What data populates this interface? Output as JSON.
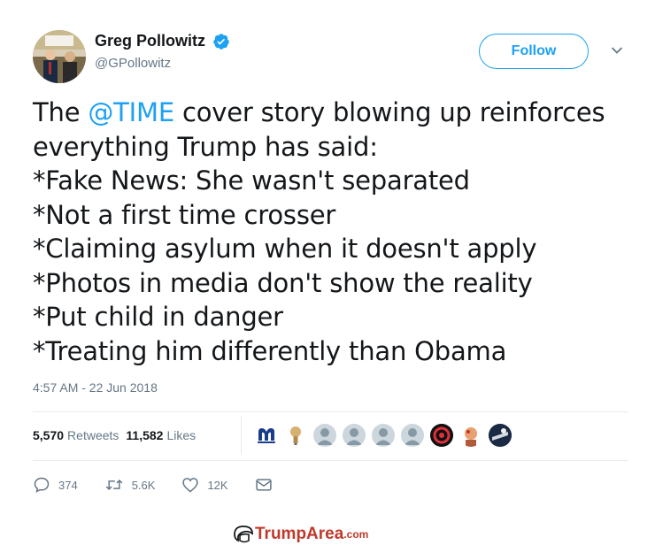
{
  "user": {
    "display_name": "Greg Pollowitz",
    "handle": "@GPollowitz",
    "verified": true
  },
  "follow_label": "Follow",
  "tweet": {
    "lines": [
      {
        "pre": "The ",
        "mention": "@TIME",
        "post": " cover story blowing up reinforces"
      },
      {
        "text": "everything Trump has said:"
      },
      {
        "text": "*Fake News: She wasn't separated"
      },
      {
        "text": "*Not a first time crosser"
      },
      {
        "text": "*Claiming asylum when it doesn't apply"
      },
      {
        "text": "*Photos in media don't show the reality"
      },
      {
        "text": "*Put child in danger"
      },
      {
        "text": "*Treating him differently than Obama"
      }
    ],
    "timestamp": "4:57 AM - 22 Jun 2018"
  },
  "stats": {
    "retweets_count": "5,570",
    "retweets_label": "Retweets",
    "likes_count": "11,582",
    "likes_label": "Likes"
  },
  "likers": [
    "m-logo-avatar",
    "lightbulb-avatar",
    "default-avatar",
    "default-avatar",
    "default-avatar",
    "default-avatar",
    "hurricanes-logo-avatar",
    "cartoon-avatar",
    "sports-logo-avatar"
  ],
  "actions": {
    "replies": "374",
    "retweets": "5.6K",
    "likes": "12K"
  },
  "colors": {
    "accent": "#1da1f2",
    "text": "#14171a",
    "muted": "#657786",
    "watermark": "#c0392b"
  },
  "watermark": {
    "main": "TrumpArea",
    "suffix": ".com"
  }
}
